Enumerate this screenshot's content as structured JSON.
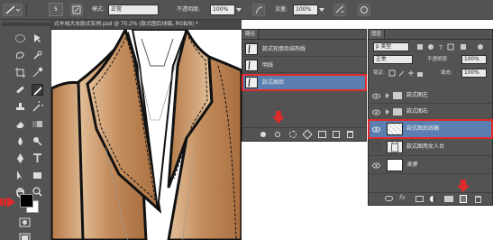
{
  "options_bar": {
    "size_value": "5",
    "mode_label": "模式:",
    "mode_value": "正常",
    "opacity_label": "不透明度:",
    "opacity_value": "100%",
    "flow_label": "流量:",
    "flow_value": "100%"
  },
  "document": {
    "tab_title": "式羊绒大衣款式实例.psd @ 70.2% (款式图后线稿, RGB/8) *",
    "close_glyph": "×"
  },
  "paths_panel": {
    "tab_label": "路径",
    "items": [
      {
        "label": "款式轮廓及结构线"
      },
      {
        "label": "明线"
      },
      {
        "label": "款式图后"
      }
    ]
  },
  "layers_panel": {
    "tab_label": "图层",
    "filter_label": "p 类型",
    "blend_mode": "正常",
    "opacity_label": "不透明度:",
    "opacity_value": "100%",
    "lock_label": "锁定:",
    "fill_label": "填充:",
    "fill_value": "100%",
    "layers": [
      {
        "name": "款式图左",
        "kind": "folder"
      },
      {
        "name": "款式图右",
        "kind": "folder"
      },
      {
        "name": "款式图后线稿",
        "kind": "layer"
      },
      {
        "name": "款式图用女人台",
        "kind": "layer"
      },
      {
        "name": "背景",
        "kind": "background"
      }
    ]
  },
  "colors": {
    "ui_dark": "#535353",
    "selection_blue": "#5a7fb0",
    "highlight_red": "#e02a2a",
    "coat_fill": "#c8956a",
    "foreground": "#000000",
    "background": "#ffffff"
  }
}
